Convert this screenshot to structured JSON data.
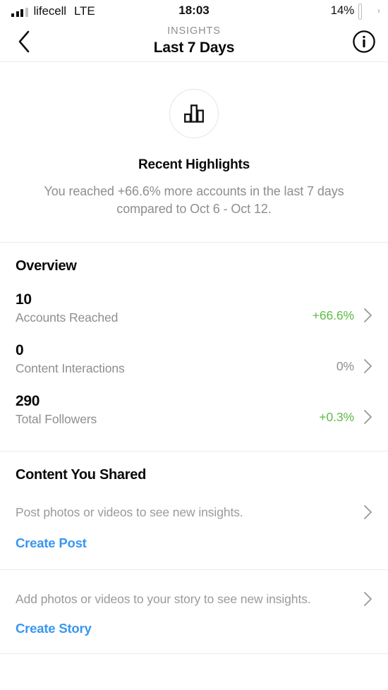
{
  "status_bar": {
    "carrier": "lifecell",
    "network": "LTE",
    "time": "18:03",
    "battery_percent": "14%",
    "battery_level": 14,
    "signal_bars_filled": 3,
    "signal_bars_total": 4
  },
  "nav": {
    "back_icon": "chevron-left-icon",
    "eyebrow": "INSIGHTS",
    "title": "Last 7 Days",
    "info_icon": "info-circle-icon"
  },
  "highlights": {
    "icon": "bar-chart-icon",
    "title": "Recent Highlights",
    "description": "You reached +66.6% more accounts in the last 7 days compared to Oct 6 - Oct 12."
  },
  "overview": {
    "title": "Overview",
    "metrics": [
      {
        "value": "10",
        "label": "Accounts Reached",
        "delta": "+66.6%",
        "delta_kind": "positive",
        "chevron": "chevron-right-icon"
      },
      {
        "value": "0",
        "label": "Content Interactions",
        "delta": "0%",
        "delta_kind": "flat",
        "chevron": "chevron-right-icon"
      },
      {
        "value": "290",
        "label": "Total Followers",
        "delta": "+0.3%",
        "delta_kind": "positive",
        "chevron": "chevron-right-icon"
      }
    ]
  },
  "content_shared": {
    "title": "Content You Shared",
    "post": {
      "empty_text": "Post photos or videos to see new insights.",
      "cta": "Create Post",
      "chevron": "chevron-right-icon"
    },
    "story": {
      "empty_text": "Add photos or videos to your story to see new insights.",
      "cta": "Create Story",
      "chevron": "chevron-right-icon"
    }
  },
  "colors": {
    "positive": "#5dbb46",
    "link": "#3897f0",
    "muted": "#8e8e8e",
    "battery_low": "#f23b30",
    "divider": "#ececec"
  }
}
